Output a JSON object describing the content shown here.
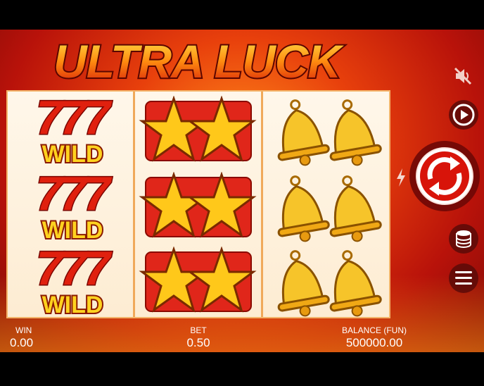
{
  "game": {
    "title": "ULTRA LUCK"
  },
  "reels": {
    "columns": [
      {
        "symbols": [
          "wild-777",
          "wild-777",
          "wild-777"
        ]
      },
      {
        "symbols": [
          "double-star",
          "double-star",
          "double-star"
        ]
      },
      {
        "symbols": [
          "double-bell",
          "double-bell",
          "double-bell"
        ]
      }
    ],
    "wild_digits": "777",
    "wild_label": "WILD"
  },
  "hud": {
    "win_label": "WIN",
    "win_value": "0.00",
    "bet_label": "BET",
    "bet_value": "0.50",
    "balance_label": "BALANCE (FUN)",
    "balance_value": "500000.00"
  },
  "controls": {
    "sound": {
      "icon": "sound-muted-icon",
      "state": "muted"
    },
    "autoplay": {
      "icon": "play-circle-icon"
    },
    "turbo": {
      "icon": "lightning-icon"
    },
    "spin": {
      "icon": "spin-arrows-icon"
    },
    "bet": {
      "icon": "coin-stack-icon"
    },
    "menu": {
      "icon": "hamburger-menu-icon"
    }
  },
  "colors": {
    "accent_red": "#c8150c",
    "gold": "#f5c21b",
    "background_orange": "#e8400c"
  }
}
